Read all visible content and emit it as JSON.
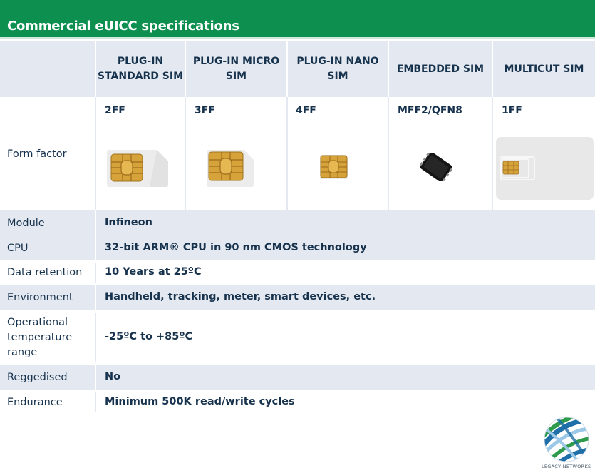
{
  "title": "Commercial eUICC specifications",
  "columns": [
    {
      "name": "PLUG-IN STANDARD SIM",
      "line1": "PLUG-IN",
      "line2": "STANDARD SIM",
      "form_factor": "2FF"
    },
    {
      "name": "PLUG-IN MICRO SIM",
      "line1": "PLUG-IN MICRO",
      "line2": "SIM",
      "form_factor": "3FF"
    },
    {
      "name": "PLUG-IN NANO SIM",
      "line1": "PLUG-IN NANO",
      "line2": "SIM",
      "form_factor": "4FF"
    },
    {
      "name": "EMBEDDED SIM",
      "line1": "EMBEDDED SIM",
      "line2": "",
      "form_factor": "MFF2/QFN8"
    },
    {
      "name": "MULTICUT SIM",
      "line1": "MULTICUT SIM",
      "line2": "",
      "form_factor": "1FF"
    }
  ],
  "form_factor_label": "Form factor",
  "specs": [
    {
      "label": "Module",
      "value": "Infineon"
    },
    {
      "label": "CPU",
      "value": "32-bit ARM® CPU in 90 nm CMOS technology"
    },
    {
      "label": "Data retention",
      "value": "10 Years at 25ºC"
    },
    {
      "label": "Environment",
      "value": "Handheld, tracking, meter, smart devices, etc."
    },
    {
      "label": "Operational temperature range",
      "line1": "Operational",
      "line2": "temperature",
      "line3": "range",
      "value": "-25ºC to +85ºC"
    },
    {
      "label": "Reggedised",
      "value": "No"
    },
    {
      "label": "Endurance",
      "value": "Minimum 500K read/write cycles"
    }
  ],
  "logo": {
    "brand_text": "LEGACY NETWORKS",
    "colors": [
      "#1e6fa8",
      "#2e9a4c",
      "#9bc8e6"
    ]
  },
  "colors": {
    "accent_green": "#0d8f4f",
    "row_shade": "#e4e9f1",
    "text": "#17324d",
    "chip_gold": "#d9a93c"
  }
}
